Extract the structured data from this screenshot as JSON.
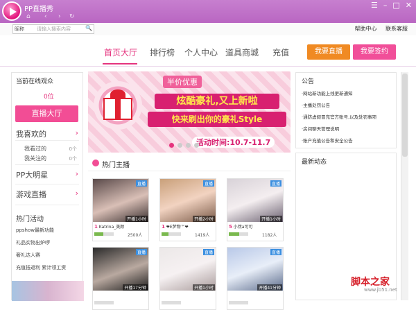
{
  "window": {
    "title": "PP直播秀"
  },
  "toolbar": {
    "search_select": "昵称",
    "search_placeholder": "请输入搜索内容",
    "help": "帮助中心",
    "contact": "联系客服"
  },
  "nav": {
    "tabs": [
      {
        "label": "首页大厅"
      },
      {
        "label": "排行榜"
      },
      {
        "label": "个人中心"
      },
      {
        "label": "道具商城"
      },
      {
        "label": "充值"
      }
    ],
    "live_button": "我要直播",
    "sign_button": "我要签约"
  },
  "left": {
    "online_label": "当前在线观众",
    "online_count": "0位",
    "hall_button": "直播大厅",
    "sections": [
      {
        "label": "我喜欢的"
      },
      {
        "label": "PP大明星"
      },
      {
        "label": "游戏直播"
      }
    ],
    "subs": [
      {
        "label": "我看过的",
        "count": "0个"
      },
      {
        "label": "我关注的",
        "count": "0个"
      }
    ],
    "activity_title": "热门活动",
    "activities": [
      {
        "label": "ppshow最新功能"
      },
      {
        "label": "礼品实物出炉啰"
      },
      {
        "label": "奢礼达人赛"
      },
      {
        "label": "充值抵返利 累计领工资"
      }
    ]
  },
  "banner": {
    "tag": "半价优惠",
    "line1": "炫酷豪礼,又上新啦",
    "line2": "快来刷出你的豪礼Style",
    "time": "活动时间:10.7-11.7"
  },
  "hot": {
    "title": "热门主播"
  },
  "streamers": [
    {
      "level": "1",
      "name": "Katrina_美颜",
      "time": "开播1小时",
      "count": "2500人",
      "badge": "直播",
      "progress": 0.45
    },
    {
      "level": "1",
      "name": "❤E梦物™❤",
      "time": "开播2小时",
      "count": "1419人",
      "badge": "直播",
      "progress": 0.35
    },
    {
      "level": "5",
      "name": "小然a可可",
      "time": "开播1小时",
      "count": "1182人",
      "badge": "直播",
      "progress": 0.55
    },
    {
      "level": "",
      "name": "",
      "time": "开播17分钟",
      "count": "",
      "badge": "直播",
      "progress": 0
    },
    {
      "level": "",
      "name": "",
      "time": "开播1小时",
      "count": "",
      "badge": "直播",
      "progress": 0
    },
    {
      "level": "",
      "name": "",
      "time": "开播41分钟",
      "count": "",
      "badge": "直播",
      "progress": 0
    }
  ],
  "notice": {
    "title": "公告",
    "items": [
      {
        "label": "·网站新功能上线更新通知"
      },
      {
        "label": "·主播处罚公告"
      },
      {
        "label": "·通防虚假冒充官方账号,以及处罚事项"
      },
      {
        "label": "·房间聊天管理说明"
      },
      {
        "label": "·账户充值公告和安全公告"
      }
    ]
  },
  "news": {
    "title": "最新动态"
  },
  "watermark": {
    "text": "脚本之家",
    "url": "www.jb51.net"
  }
}
